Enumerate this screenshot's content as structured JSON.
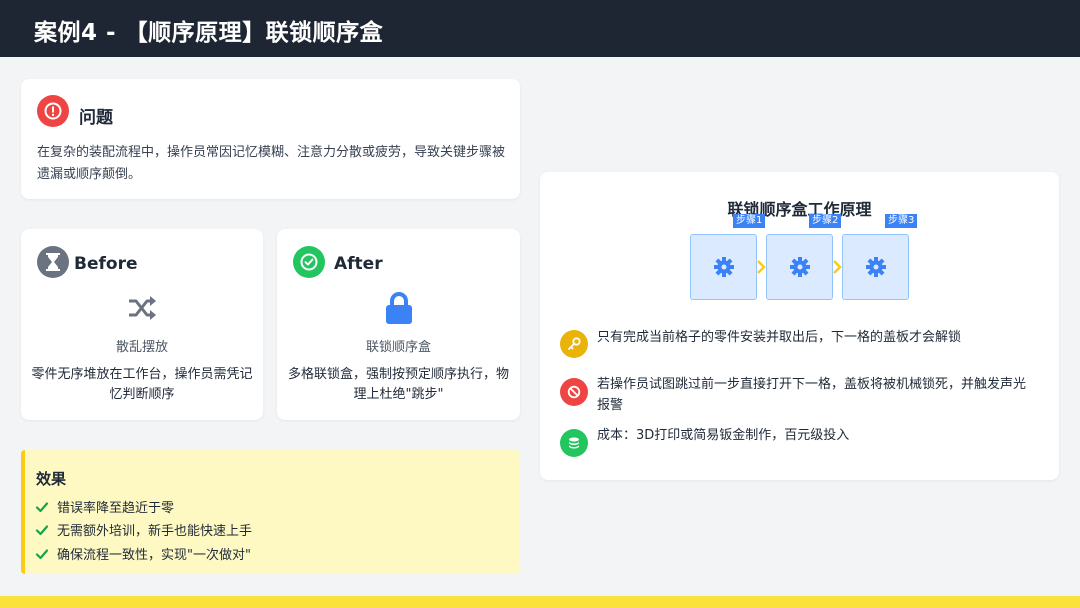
{
  "header": {
    "title": "案例4 - 【顺序原理】联锁顺序盒"
  },
  "problem": {
    "icon": "exclamation-icon",
    "title": "问题",
    "description": "在复杂的装配流程中，操作员常因记忆模糊、注意力分散或疲劳，导致关键步骤被遗漏或顺序颠倒。"
  },
  "before": {
    "icon": "hourglass-icon",
    "title": "Before",
    "symbol": "shuffle-icon",
    "subtitle": "散乱摆放",
    "description": "零件无序堆放在工作台，操作员需凭记忆判断顺序"
  },
  "after": {
    "icon": "check-circle-icon",
    "title": "After",
    "symbol": "lock-icon",
    "subtitle": "联锁顺序盒",
    "description": "多格联锁盒，强制按预定顺序执行，物理上杜绝\"跳步\""
  },
  "effect": {
    "title": "效果",
    "items": [
      "错误率降至趋近于零",
      "无需额外培训，新手也能快速上手",
      "确保流程一致性，实现\"一次做对\""
    ]
  },
  "principle": {
    "title": "联锁顺序盒工作原理",
    "steps": [
      "步骤1",
      "步骤2",
      "步骤3"
    ],
    "features": [
      {
        "icon": "key-icon",
        "color": "#eab308",
        "text": "只有完成当前格子的零件安装并取出后，下一格的盖板才会解锁"
      },
      {
        "icon": "ban-icon",
        "color": "#ef4444",
        "text": "若操作员试图跳过前一步直接打开下一格，盖板将被机械锁死，并触发声光报警"
      },
      {
        "icon": "coins-icon",
        "color": "#22c55e",
        "text": "成本：3D打印或简易钣金制作，百元级投入"
      }
    ]
  },
  "colors": {
    "header_bg": "#1e2633",
    "accent_yellow": "#fbe13b",
    "step_blue": "#3b82f6",
    "danger": "#ef4444",
    "success": "#22c55e"
  }
}
